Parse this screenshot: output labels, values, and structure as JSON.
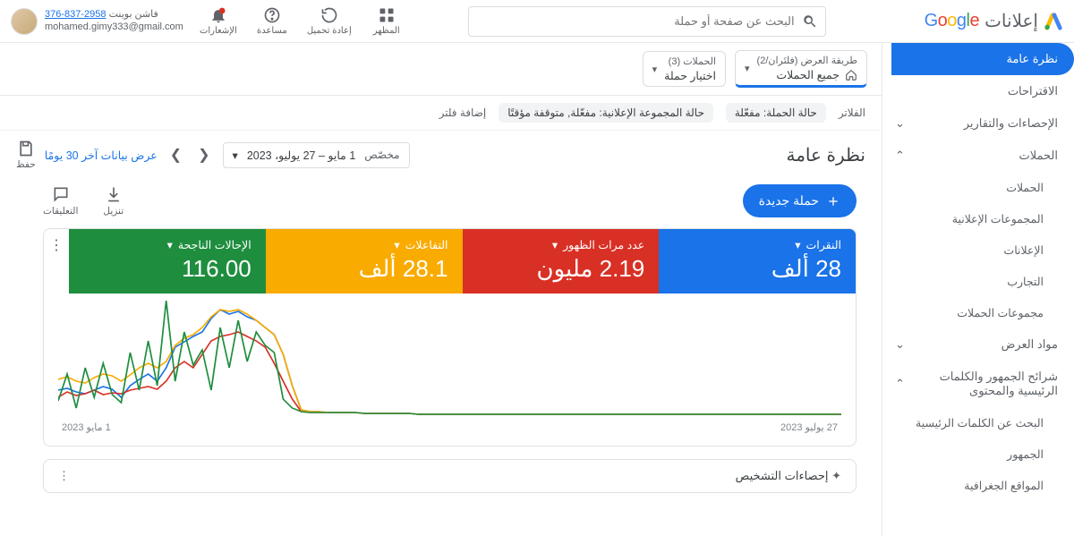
{
  "brand": {
    "product": "إعلانات"
  },
  "search": {
    "placeholder": "البحث عن صفحة أو حملة"
  },
  "tools": {
    "appearance": "المظهر",
    "reload": "إعادة تحميل",
    "help": "مساعدة",
    "notifications": "الإشعارات"
  },
  "account": {
    "line1_text": " فاشن بوينت",
    "line1_num": "376-837-2958",
    "email": "mohamed.gimy333@gmail.com"
  },
  "nav": {
    "overview": "نظرة عامة",
    "suggestions": "الاقتراحات",
    "stats": "الإحصاءات والتقارير",
    "campaigns_h": "الحملات",
    "campaigns": "الحملات",
    "adgroups": "المجموعات الإعلانية",
    "ads": "الإعلانات",
    "experiments": "التجارب",
    "campaign_groups": "مجموعات الحملات",
    "assets": "مواد العرض",
    "audiences_h": "شرائح الجمهور والكلمات الرئيسية والمحتوى",
    "kw_search": "البحث عن الكلمات الرئيسية",
    "audiences": "الجمهور",
    "geo": "المواقع الجغرافية"
  },
  "crumbs": {
    "view_lbl": "طريقة العرض (فلتَران/2)",
    "view_val": "جميع الحملات",
    "camp_lbl": "الحملات (3)",
    "camp_val": "اختيار حملة"
  },
  "filters": {
    "label": "الفلاتر",
    "c1": "حالة الحملة: مفعّلة",
    "c2": "حالة المجموعة الإعلانية: مفعّلة, متوقفة مؤقتًا",
    "add": "إضافة فلتر"
  },
  "title": "نظرة عامة",
  "date": {
    "custom": "مخصّص",
    "range": "1 مايو – 27 يوليو، 2023",
    "last30": "عرض بيانات آخر 30 يومًا"
  },
  "save": "حفظ",
  "new_campaign": "حملة جديدة",
  "mini": {
    "download": "تنزيل",
    "comments": "التعليقات"
  },
  "metrics": {
    "clicks_l": "النقرات",
    "clicks_v": "28 ألف",
    "impr_l": "عدد مرات الظهور",
    "impr_v": "2.19 مليون",
    "inter_l": "التفاعلات",
    "inter_v": "28.1 ألف",
    "conv_l": "الإحالات الناجحة",
    "conv_v": "116.00"
  },
  "axis": {
    "start": "27 يوليو 2023",
    "end": "1 مايو 2023"
  },
  "diag_title": "إحصاءات التشخيص",
  "chart_data": {
    "type": "line",
    "x_start": "27 يوليو 2023",
    "x_end": "1 مايو 2023",
    "series": [
      {
        "name": "النقرات",
        "color": "#1a73e8",
        "values": [
          30,
          32,
          28,
          26,
          30,
          34,
          31,
          22,
          35,
          42,
          48,
          40,
          55,
          78,
          84,
          90,
          95,
          110,
          120,
          115,
          118,
          112,
          108,
          100,
          92,
          70,
          35,
          8,
          6,
          6,
          5,
          5,
          5,
          5,
          4,
          4,
          4,
          4,
          4,
          4,
          3,
          3,
          3,
          3,
          3,
          3,
          3,
          3,
          3,
          3,
          3,
          3,
          3,
          3,
          3,
          3,
          3,
          3,
          3,
          3,
          3,
          3,
          3,
          3,
          3,
          3,
          3,
          3,
          3,
          3,
          3,
          3,
          3,
          3,
          3,
          3,
          3,
          3,
          3,
          3,
          3,
          3,
          3,
          3,
          3,
          3,
          3,
          3
        ]
      },
      {
        "name": "عدد مرات الظهور",
        "color": "#d93025",
        "values": [
          22,
          28,
          24,
          26,
          30,
          25,
          27,
          26,
          30,
          32,
          34,
          31,
          40,
          55,
          62,
          55,
          70,
          85,
          90,
          92,
          95,
          90,
          85,
          78,
          60,
          40,
          20,
          6,
          5,
          5,
          5,
          5,
          5,
          5,
          4,
          4,
          4,
          4,
          4,
          4,
          3,
          3,
          3,
          3,
          3,
          3,
          3,
          3,
          3,
          3,
          3,
          3,
          3,
          3,
          3,
          3,
          3,
          3,
          3,
          3,
          3,
          3,
          3,
          3,
          3,
          3,
          3,
          3,
          3,
          3,
          3,
          3,
          3,
          3,
          3,
          3,
          3,
          3,
          3,
          3,
          3,
          3,
          3,
          3,
          3,
          3,
          3,
          3
        ]
      },
      {
        "name": "التفاعلات",
        "color": "#f9ab00",
        "values": [
          42,
          45,
          40,
          38,
          44,
          48,
          46,
          40,
          47,
          55,
          60,
          55,
          62,
          80,
          88,
          92,
          100,
          112,
          120,
          118,
          120,
          115,
          108,
          100,
          92,
          70,
          35,
          8,
          6,
          6,
          5,
          5,
          5,
          5,
          4,
          4,
          4,
          4,
          4,
          4,
          3,
          3,
          3,
          3,
          3,
          3,
          3,
          3,
          3,
          3,
          3,
          3,
          3,
          3,
          3,
          3,
          3,
          3,
          3,
          3,
          3,
          3,
          3,
          3,
          3,
          3,
          3,
          3,
          3,
          3,
          3,
          3,
          3,
          3,
          3,
          3,
          3,
          3,
          3,
          3,
          3,
          3,
          3,
          3,
          3,
          3,
          3,
          3
        ]
      },
      {
        "name": "الإحالات الناجحة",
        "color": "#1e8e3e",
        "values": [
          18,
          48,
          10,
          55,
          22,
          60,
          25,
          16,
          72,
          30,
          85,
          35,
          130,
          40,
          95,
          58,
          75,
          30,
          100,
          55,
          108,
          62,
          95,
          80,
          72,
          20,
          10,
          6,
          5,
          5,
          5,
          5,
          5,
          5,
          4,
          4,
          4,
          4,
          4,
          4,
          3,
          3,
          3,
          3,
          3,
          3,
          3,
          3,
          3,
          3,
          3,
          3,
          3,
          3,
          3,
          3,
          3,
          3,
          3,
          3,
          3,
          3,
          3,
          3,
          3,
          3,
          3,
          3,
          3,
          3,
          3,
          3,
          3,
          3,
          3,
          3,
          3,
          3,
          3,
          3,
          3,
          3,
          3,
          3,
          3,
          3,
          3,
          3
        ]
      }
    ],
    "ylim": [
      0,
      130
    ]
  }
}
